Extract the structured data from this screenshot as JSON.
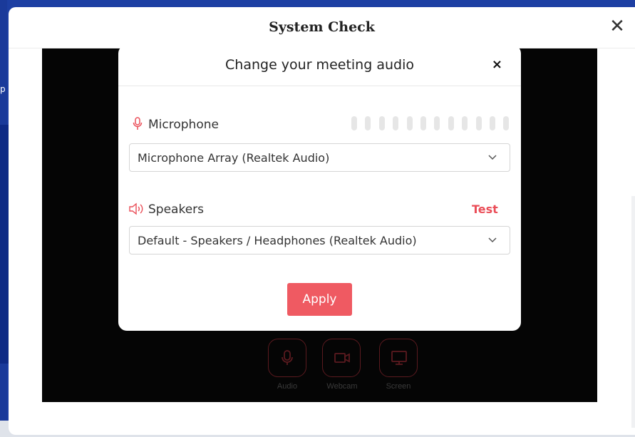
{
  "background": {
    "left_partial_text": "p"
  },
  "outer_modal": {
    "title": "System Check",
    "close_glyph": "✕"
  },
  "inner_modal": {
    "title": "Change your meeting audio",
    "close_glyph": "×",
    "microphone": {
      "label": "Microphone",
      "icon": "microphone-icon",
      "selected": "Microphone Array (Realtek Audio)",
      "level_bar_count": 12
    },
    "speakers": {
      "label": "Speakers",
      "icon": "speaker-icon",
      "test_label": "Test",
      "selected": "Default - Speakers / Headphones (Realtek Audio)"
    },
    "apply_label": "Apply"
  },
  "controls": [
    {
      "label": "Audio",
      "icon": "microphone-icon"
    },
    {
      "label": "Webcam",
      "icon": "webcam-icon"
    },
    {
      "label": "Screen",
      "icon": "screen-icon"
    }
  ],
  "colors": {
    "accent": "#ef5a62",
    "background_blue": "#1d3fa3",
    "video_bg": "#050505"
  }
}
